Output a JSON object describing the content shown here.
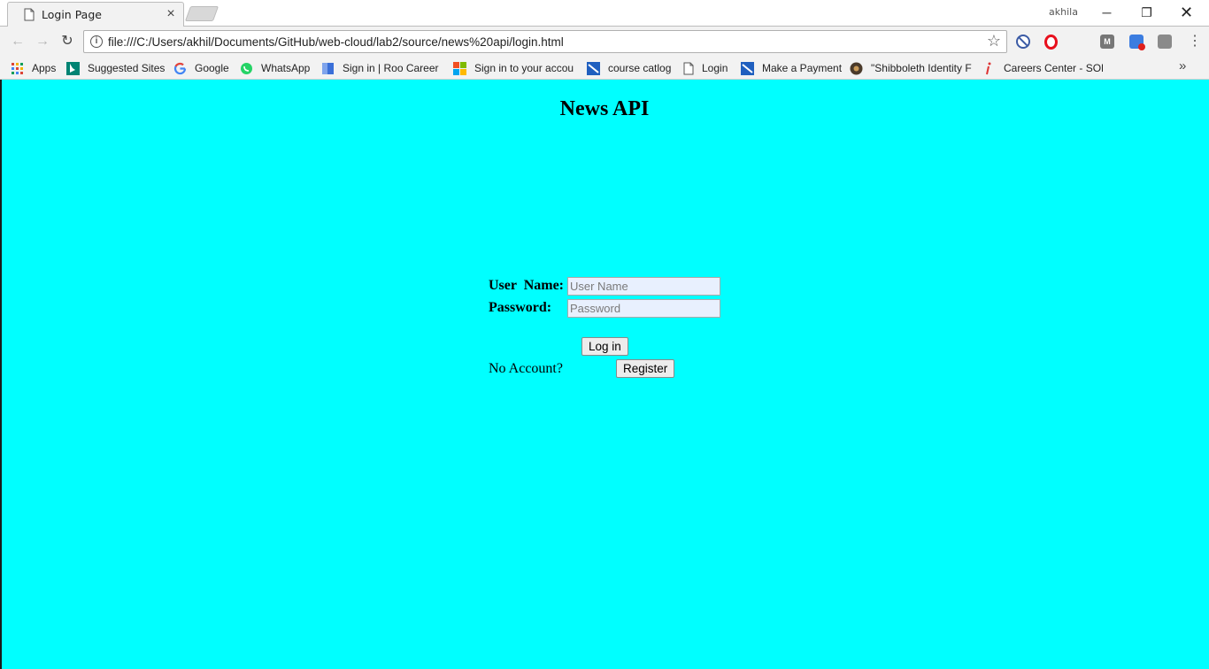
{
  "window": {
    "profile_name": "akhila",
    "minimize": "─",
    "maximize": "❐",
    "close": "✕"
  },
  "tab": {
    "title": "Login Page",
    "close_glyph": "×",
    "icon": "page-icon"
  },
  "toolbar": {
    "back_glyph": "←",
    "forward_glyph": "→",
    "reload_glyph": "↻",
    "info_glyph": "i",
    "url": "file:///C:/Users/akhil/Documents/GitHub/web-cloud/lab2/source/news%20api/login.html",
    "star_glyph": "☆",
    "extensions": [
      "block-icon",
      "opera-icon",
      "m-extension-icon",
      "shield-extension-icon",
      "grey-extension-icon"
    ],
    "menu_glyph": "⋮"
  },
  "bookmarks": {
    "items": [
      {
        "label": "Apps",
        "icon": "apps-grid-icon"
      },
      {
        "label": "Suggested Sites",
        "icon": "bing-icon"
      },
      {
        "label": "Google",
        "icon": "google-icon"
      },
      {
        "label": "WhatsApp",
        "icon": "whatsapp-icon"
      },
      {
        "label": "Sign in | Roo Career N",
        "icon": "roo-career-icon"
      },
      {
        "label": "Sign in to your accou",
        "icon": "microsoft-icon"
      },
      {
        "label": "course catlog",
        "icon": "umkc-icon"
      },
      {
        "label": "Login",
        "icon": "page-icon"
      },
      {
        "label": "Make a Payment",
        "icon": "umkc-icon"
      },
      {
        "label": "\"Shibboleth Identity F",
        "icon": "shibboleth-icon"
      },
      {
        "label": "Careers Center - SOF",
        "icon": "info-i-icon"
      }
    ],
    "more_glyph": "»"
  },
  "page": {
    "heading": "News API",
    "username_label": "User  Name:",
    "username_placeholder": "User Name",
    "username_value": "",
    "password_label": "Password:",
    "password_placeholder": "Password",
    "password_value": "",
    "login_button": "Log in",
    "no_account_text": "No Account?",
    "register_button": "Register"
  },
  "colors": {
    "page_background": "#00ffff",
    "chrome_background": "#f2f2f2",
    "input_autofill_background": "#e8f0fe"
  }
}
